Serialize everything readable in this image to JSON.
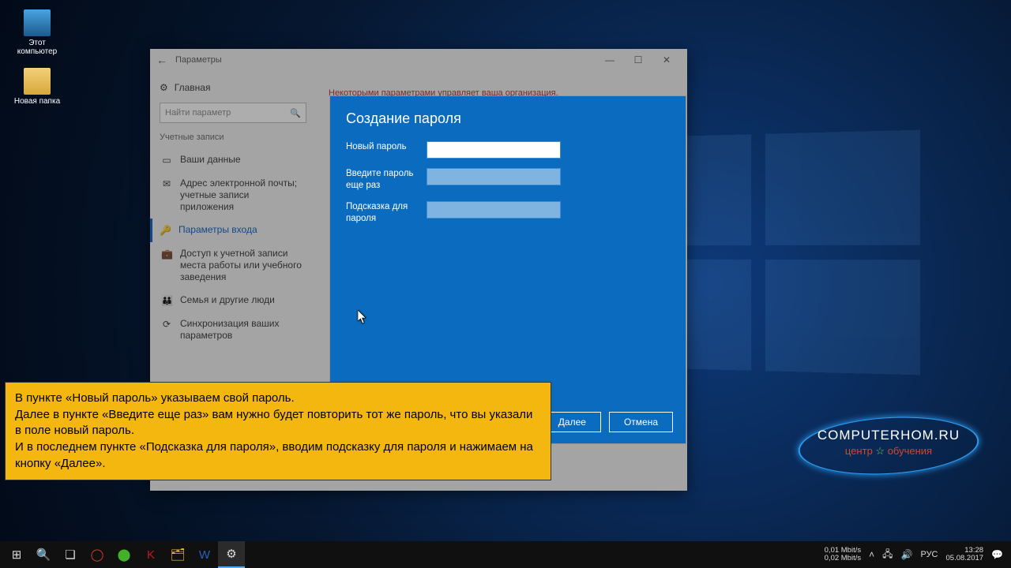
{
  "desktop": {
    "icons": [
      {
        "label": "Этот компьютер"
      },
      {
        "label": "Новая папка"
      }
    ]
  },
  "settings": {
    "title": "Параметры",
    "home": "Главная",
    "search_placeholder": "Найти параметр",
    "category": "Учетные записи",
    "org_message": "Некоторыми параметрами управляет ваша организация.",
    "nav": [
      "Ваши данные",
      "Адрес электронной почты; учетные записи приложения",
      "Параметры входа",
      "Доступ к учетной записи места работы или учебного заведения",
      "Семья и другие люди",
      "Синхронизация ваших параметров"
    ]
  },
  "dialog": {
    "title": "Создание пароля",
    "new_pwd": "Новый пароль",
    "repeat_pwd": "Введите пароль еще раз",
    "hint": "Подсказка для пароля",
    "next": "Далее",
    "cancel": "Отмена"
  },
  "caption": {
    "l1": "В пункте «Новый пароль» указываем свой пароль.",
    "l2": "Далее в пункте «Введите еще раз» вам нужно будет повторить тот же пароль, что вы указали в поле новый пароль.",
    "l3": "И в последнем пункте «Подсказка для пароля», вводим подсказку для пароля и нажимаем на кнопку «Далее»."
  },
  "brand": {
    "line1": "COMPUTERHOM.RU",
    "line2_a": "центр ",
    "line2_b": " обучения"
  },
  "tray": {
    "net_up": "0,01 Mbit/s",
    "net_dn": "0,02 Mbit/s",
    "lang": "РУС",
    "time": "13:28",
    "date": "05.08.2017"
  }
}
